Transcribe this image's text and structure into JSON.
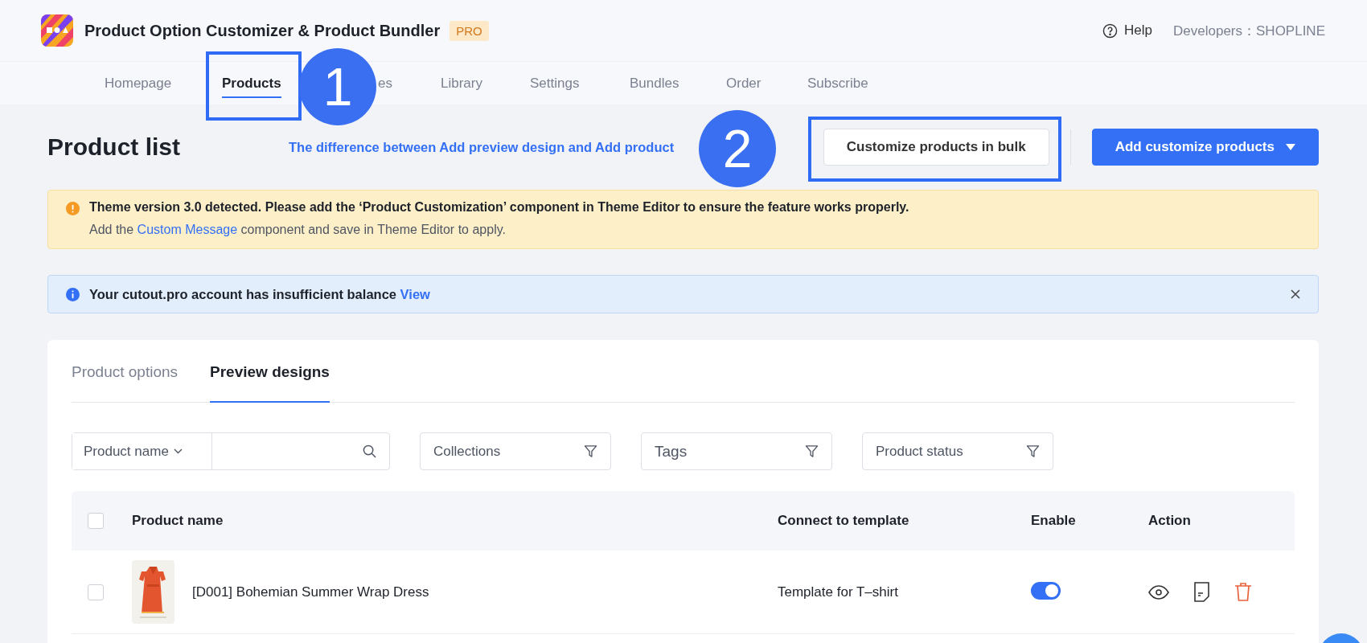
{
  "app": {
    "title": "Product Option Customizer & Product Bundler",
    "badge": "PRO",
    "help": "Help",
    "developer": "Developers：SHOPLINE"
  },
  "nav": [
    {
      "label": "Homepage",
      "selected": false
    },
    {
      "label": "Products",
      "selected": true
    },
    {
      "label": "es",
      "selected": false
    },
    {
      "label": "Library",
      "selected": false
    },
    {
      "label": "Settings",
      "selected": false
    },
    {
      "label": "Bundles",
      "selected": false
    },
    {
      "label": "Order",
      "selected": false
    },
    {
      "label": "Subscribe",
      "selected": false
    }
  ],
  "page": {
    "title": "Product list",
    "help_link": "The difference between Add preview design and Add product",
    "bulk_button": "Customize products in bulk",
    "add_button": "Add customize products"
  },
  "warning": {
    "line1": "Theme version 3.0 detected. Please add the ‘Product Customization’ component in Theme Editor to ensure the feature works properly.",
    "line2_before": "Add the ",
    "line2_link": "Custom Message",
    "line2_after": " component and save in Theme Editor to apply."
  },
  "info": {
    "text": "Your cutout.pro account has insufficient balance",
    "link": "View"
  },
  "tabs": [
    {
      "label": "Product options",
      "selected": false
    },
    {
      "label": "Preview designs",
      "selected": true
    }
  ],
  "filters": {
    "field_select": "Product name",
    "dropdowns": [
      "Collections",
      "Tags",
      "Product status"
    ]
  },
  "table": {
    "all_checked": false,
    "columns": [
      "Product name",
      "Connect to template",
      "Enable",
      "Action"
    ],
    "rows": [
      {
        "name": "[D001] Bohemian Summer Wrap Dress",
        "template": "Template for T–shirt",
        "enabled": true,
        "checked": false
      }
    ]
  },
  "annotations": [
    {
      "number": "1"
    },
    {
      "number": "2"
    }
  ]
}
